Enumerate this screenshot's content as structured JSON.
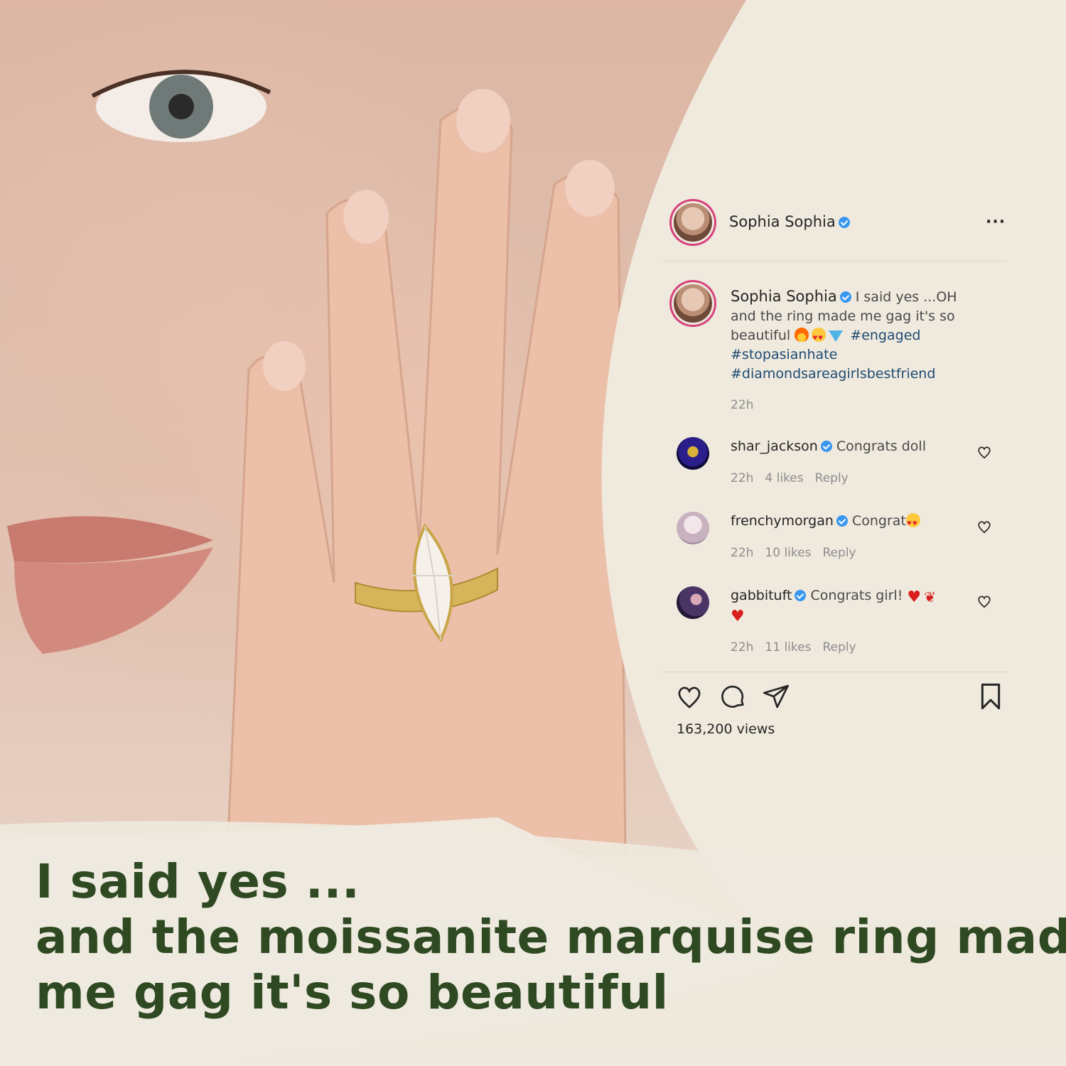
{
  "post": {
    "author": "Sophia Sophia",
    "more_icon": "more-horizontal-icon",
    "caption_author": "Sophia Sophia",
    "caption_text": "I said yes ...OH and the ring made me gag it's so beautiful",
    "hashtags": [
      "#engaged",
      "#stopasianhate",
      "#diamondsareagirlsbestfriend"
    ],
    "caption_time": "22h",
    "views": "163,200 views"
  },
  "comments": [
    {
      "user": "shar_jackson",
      "text": "Congrats doll",
      "time": "22h",
      "likes": "4 likes",
      "reply": "Reply"
    },
    {
      "user": "frenchymorgan",
      "text": "Congrat",
      "time": "22h",
      "likes": "10 likes",
      "reply": "Reply"
    },
    {
      "user": "gabbituft",
      "text": "Congrats girl!",
      "time": "22h",
      "likes": "11 likes",
      "reply": "Reply"
    }
  ],
  "headline": {
    "line1": "I said yes ...",
    "line2": "and the moissanite marquise ring made",
    "line3": "me gag it's so beautiful"
  },
  "colors": {
    "panel": "#efe9de",
    "headline": "#2f4a22",
    "hashtag": "#1e4b72",
    "verified": "#3897f0",
    "muted": "#8e8e8e"
  }
}
